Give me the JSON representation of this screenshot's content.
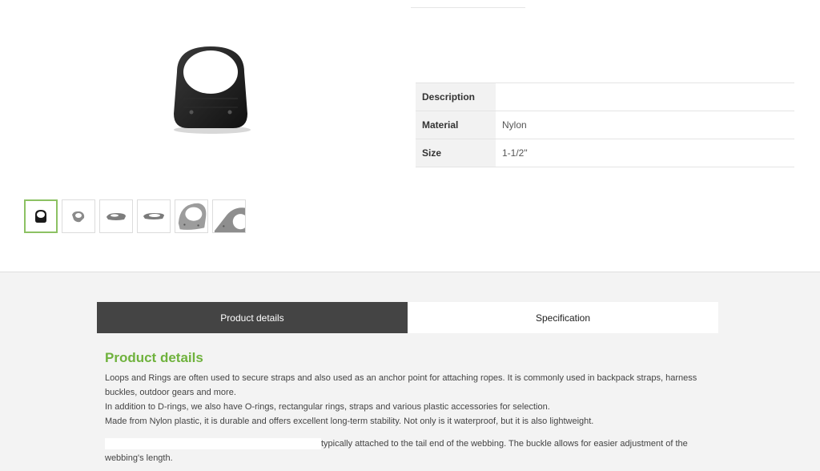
{
  "specs": [
    {
      "label": "Description",
      "value": ""
    },
    {
      "label": "Material",
      "value": "Nylon"
    },
    {
      "label": "Size",
      "value": "1-1/2\""
    }
  ],
  "thumbnails": [
    {
      "icon": "d-ring-front-icon"
    },
    {
      "icon": "d-ring-angle-icon"
    },
    {
      "icon": "d-ring-side-icon"
    },
    {
      "icon": "d-ring-flat-icon"
    },
    {
      "icon": "d-ring-closeup-icon"
    },
    {
      "icon": "d-ring-detail-icon"
    }
  ],
  "tabs": {
    "details_label": "Product details",
    "spec_label": "Specification"
  },
  "details": {
    "heading": "Product details",
    "para1": "Loops and Rings are often used to secure straps and also used as an anchor point for attaching ropes. It is commonly used in backpack straps, harness buckles, outdoor gears and more.",
    "para2": "In addition to D-rings, we also have O-rings, rectangular rings, straps and various plastic accessories for selection.",
    "para3": "Made from Nylon plastic, it is durable and offers excellent long-term stability. Not only is it waterproof, but it is also lightweight.",
    "para4_tail": "typically attached to the tail end of the webbing. The buckle allows for easier adjustment of the webbing's length."
  },
  "colors": {
    "accent_green": "#6fb23d",
    "tab_active_bg": "#444444"
  }
}
